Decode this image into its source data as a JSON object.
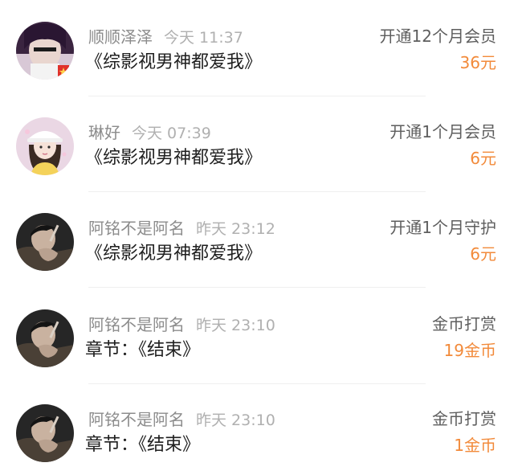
{
  "rows": [
    {
      "name": "顺顺泽泽",
      "time": "今天 11:37",
      "content": "《综影视男神都爱我》",
      "action": "开通12个月会员",
      "amount": "36元",
      "avatar_icon": "user-avatar-purple"
    },
    {
      "name": "琳好",
      "time": "今天 07:39",
      "content": "《综影视男神都爱我》",
      "action": "开通1个月会员",
      "amount": "6元",
      "avatar_icon": "user-avatar-girl-hat"
    },
    {
      "name": "阿铭不是阿名",
      "time": "昨天 23:12",
      "content": "《综影视男神都爱我》",
      "action": "开通1个月守护",
      "amount": "6元",
      "avatar_icon": "user-avatar-dark"
    },
    {
      "name": "阿铭不是阿名",
      "time": "昨天 23:10",
      "content": "章节：《结束》",
      "action": "金币打赏",
      "amount": "19金币",
      "avatar_icon": "user-avatar-dark"
    },
    {
      "name": "阿铭不是阿名",
      "time": "昨天 23:10",
      "content": "章节：《结束》",
      "action": "金币打赏",
      "amount": "1金币",
      "avatar_icon": "user-avatar-dark"
    }
  ],
  "colors": {
    "amount": "#f28a3a",
    "name": "#8c8c8c",
    "time": "#b0b0b0",
    "content": "#1f1f1f",
    "action": "#5e5e5e"
  }
}
